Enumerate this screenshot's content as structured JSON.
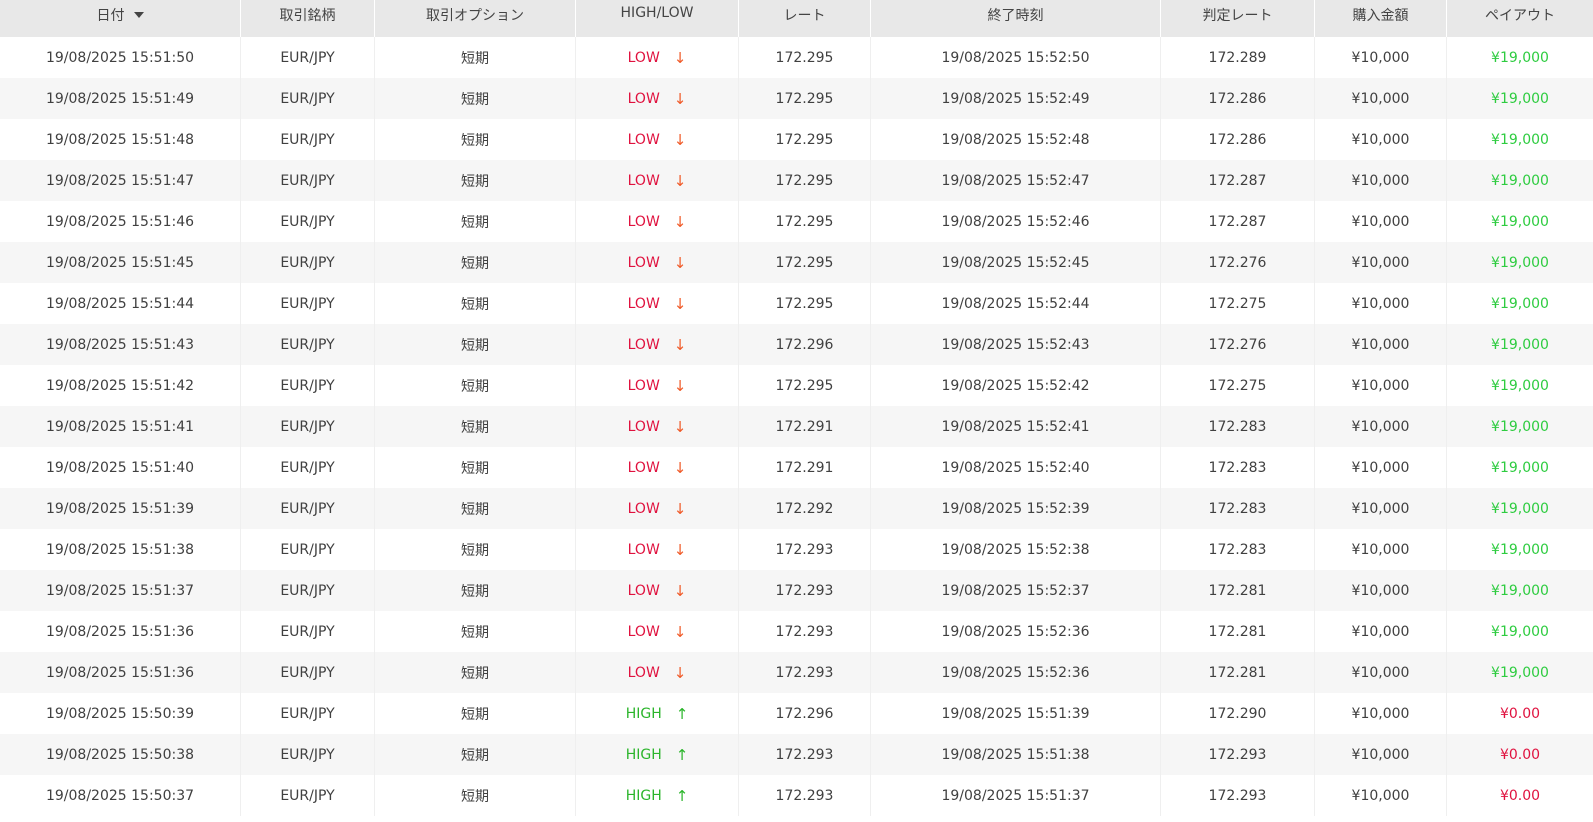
{
  "header": {
    "date": "日付",
    "symbol": "取引銘柄",
    "option": "取引オプション",
    "direction": "HIGH/LOW",
    "rate": "レート",
    "end_time": "終了時刻",
    "judge_rate": "判定レート",
    "amount": "購入金額",
    "payout": "ペイアウト"
  },
  "colors": {
    "low": "#e0123f",
    "low_arrow": "#f05a28",
    "high": "#2bb52b",
    "win": "#2ecc40",
    "lose": "#e0123f"
  },
  "rows": [
    {
      "date": "19/08/2025 15:51:50",
      "symbol": "EUR/JPY",
      "option": "短期",
      "dir": "LOW",
      "arrow": "↓",
      "rate": "172.295",
      "end": "19/08/2025 15:52:50",
      "judge": "172.289",
      "amount": "¥10,000",
      "payout": "¥19,000"
    },
    {
      "date": "19/08/2025 15:51:49",
      "symbol": "EUR/JPY",
      "option": "短期",
      "dir": "LOW",
      "arrow": "↓",
      "rate": "172.295",
      "end": "19/08/2025 15:52:49",
      "judge": "172.286",
      "amount": "¥10,000",
      "payout": "¥19,000"
    },
    {
      "date": "19/08/2025 15:51:48",
      "symbol": "EUR/JPY",
      "option": "短期",
      "dir": "LOW",
      "arrow": "↓",
      "rate": "172.295",
      "end": "19/08/2025 15:52:48",
      "judge": "172.286",
      "amount": "¥10,000",
      "payout": "¥19,000"
    },
    {
      "date": "19/08/2025 15:51:47",
      "symbol": "EUR/JPY",
      "option": "短期",
      "dir": "LOW",
      "arrow": "↓",
      "rate": "172.295",
      "end": "19/08/2025 15:52:47",
      "judge": "172.287",
      "amount": "¥10,000",
      "payout": "¥19,000"
    },
    {
      "date": "19/08/2025 15:51:46",
      "symbol": "EUR/JPY",
      "option": "短期",
      "dir": "LOW",
      "arrow": "↓",
      "rate": "172.295",
      "end": "19/08/2025 15:52:46",
      "judge": "172.287",
      "amount": "¥10,000",
      "payout": "¥19,000"
    },
    {
      "date": "19/08/2025 15:51:45",
      "symbol": "EUR/JPY",
      "option": "短期",
      "dir": "LOW",
      "arrow": "↓",
      "rate": "172.295",
      "end": "19/08/2025 15:52:45",
      "judge": "172.276",
      "amount": "¥10,000",
      "payout": "¥19,000"
    },
    {
      "date": "19/08/2025 15:51:44",
      "symbol": "EUR/JPY",
      "option": "短期",
      "dir": "LOW",
      "arrow": "↓",
      "rate": "172.295",
      "end": "19/08/2025 15:52:44",
      "judge": "172.275",
      "amount": "¥10,000",
      "payout": "¥19,000"
    },
    {
      "date": "19/08/2025 15:51:43",
      "symbol": "EUR/JPY",
      "option": "短期",
      "dir": "LOW",
      "arrow": "↓",
      "rate": "172.296",
      "end": "19/08/2025 15:52:43",
      "judge": "172.276",
      "amount": "¥10,000",
      "payout": "¥19,000"
    },
    {
      "date": "19/08/2025 15:51:42",
      "symbol": "EUR/JPY",
      "option": "短期",
      "dir": "LOW",
      "arrow": "↓",
      "rate": "172.295",
      "end": "19/08/2025 15:52:42",
      "judge": "172.275",
      "amount": "¥10,000",
      "payout": "¥19,000"
    },
    {
      "date": "19/08/2025 15:51:41",
      "symbol": "EUR/JPY",
      "option": "短期",
      "dir": "LOW",
      "arrow": "↓",
      "rate": "172.291",
      "end": "19/08/2025 15:52:41",
      "judge": "172.283",
      "amount": "¥10,000",
      "payout": "¥19,000"
    },
    {
      "date": "19/08/2025 15:51:40",
      "symbol": "EUR/JPY",
      "option": "短期",
      "dir": "LOW",
      "arrow": "↓",
      "rate": "172.291",
      "end": "19/08/2025 15:52:40",
      "judge": "172.283",
      "amount": "¥10,000",
      "payout": "¥19,000"
    },
    {
      "date": "19/08/2025 15:51:39",
      "symbol": "EUR/JPY",
      "option": "短期",
      "dir": "LOW",
      "arrow": "↓",
      "rate": "172.292",
      "end": "19/08/2025 15:52:39",
      "judge": "172.283",
      "amount": "¥10,000",
      "payout": "¥19,000"
    },
    {
      "date": "19/08/2025 15:51:38",
      "symbol": "EUR/JPY",
      "option": "短期",
      "dir": "LOW",
      "arrow": "↓",
      "rate": "172.293",
      "end": "19/08/2025 15:52:38",
      "judge": "172.283",
      "amount": "¥10,000",
      "payout": "¥19,000"
    },
    {
      "date": "19/08/2025 15:51:37",
      "symbol": "EUR/JPY",
      "option": "短期",
      "dir": "LOW",
      "arrow": "↓",
      "rate": "172.293",
      "end": "19/08/2025 15:52:37",
      "judge": "172.281",
      "amount": "¥10,000",
      "payout": "¥19,000"
    },
    {
      "date": "19/08/2025 15:51:36",
      "symbol": "EUR/JPY",
      "option": "短期",
      "dir": "LOW",
      "arrow": "↓",
      "rate": "172.293",
      "end": "19/08/2025 15:52:36",
      "judge": "172.281",
      "amount": "¥10,000",
      "payout": "¥19,000"
    },
    {
      "date": "19/08/2025 15:51:36",
      "symbol": "EUR/JPY",
      "option": "短期",
      "dir": "LOW",
      "arrow": "↓",
      "rate": "172.293",
      "end": "19/08/2025 15:52:36",
      "judge": "172.281",
      "amount": "¥10,000",
      "payout": "¥19,000"
    },
    {
      "date": "19/08/2025 15:50:39",
      "symbol": "EUR/JPY",
      "option": "短期",
      "dir": "HIGH",
      "arrow": "↑",
      "rate": "172.296",
      "end": "19/08/2025 15:51:39",
      "judge": "172.290",
      "amount": "¥10,000",
      "payout": "¥0.00"
    },
    {
      "date": "19/08/2025 15:50:38",
      "symbol": "EUR/JPY",
      "option": "短期",
      "dir": "HIGH",
      "arrow": "↑",
      "rate": "172.293",
      "end": "19/08/2025 15:51:38",
      "judge": "172.293",
      "amount": "¥10,000",
      "payout": "¥0.00"
    },
    {
      "date": "19/08/2025 15:50:37",
      "symbol": "EUR/JPY",
      "option": "短期",
      "dir": "HIGH",
      "arrow": "↑",
      "rate": "172.293",
      "end": "19/08/2025 15:51:37",
      "judge": "172.293",
      "amount": "¥10,000",
      "payout": "¥0.00"
    }
  ]
}
